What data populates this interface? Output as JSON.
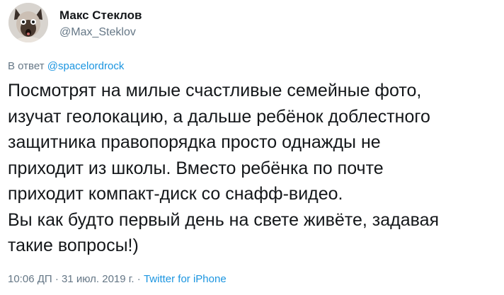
{
  "author": {
    "name": "Макс Стеклов",
    "handle": "@Max_Steklov"
  },
  "reply": {
    "prefix": "В ответ",
    "target": "@spacelordrock"
  },
  "tweet": {
    "lines": [
      "Посмотрят на милые счастливые семейные фото,",
      "изучат геолокацию, а дальше ребёнок доблестного",
      "защитника правопорядка просто однажды не",
      "приходит из школы. Вместо ребёнка по почте",
      "приходит компакт-диск со снафф-видео.",
      "Вы как будто первый день на свете живёте, задавая",
      "такие вопросы!)"
    ]
  },
  "meta": {
    "time": "10:06 ДП",
    "separator": "·",
    "date": "31 июл. 2019 г.",
    "source": "Twitter for iPhone"
  },
  "colors": {
    "text": "#14171a",
    "secondary": "#657786",
    "link": "#1b95e0"
  }
}
